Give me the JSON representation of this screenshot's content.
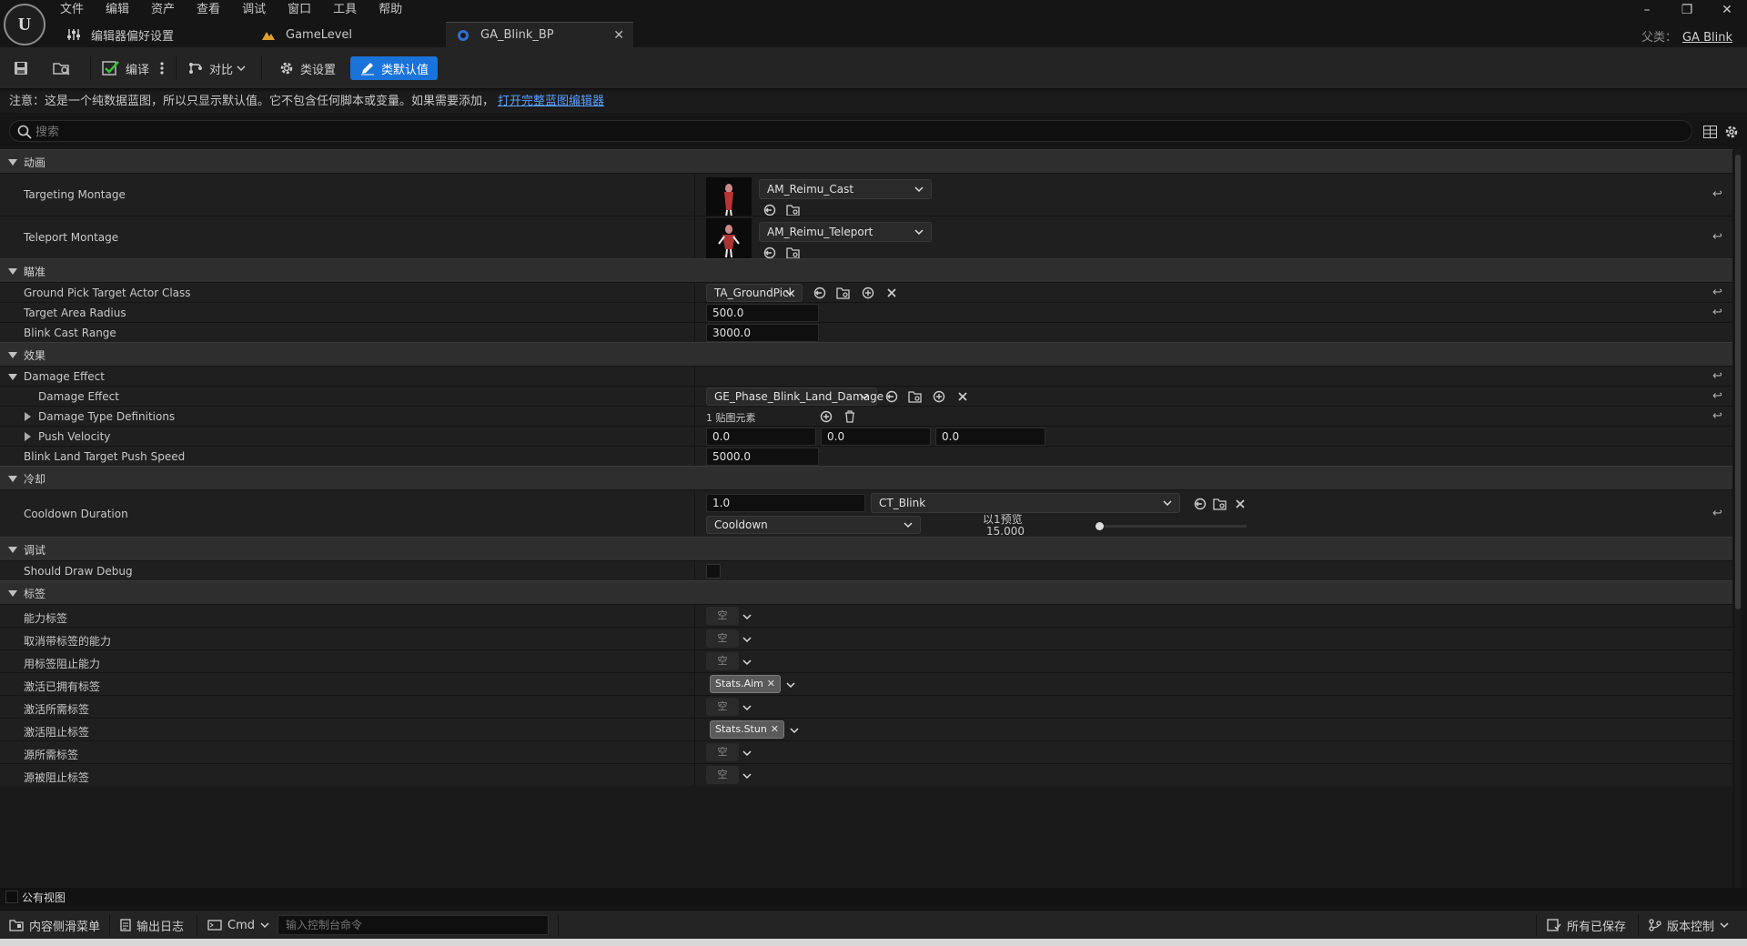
{
  "menu": [
    "文件",
    "编辑",
    "资产",
    "查看",
    "调试",
    "窗口",
    "工具",
    "帮助"
  ],
  "tabs": {
    "editor_prefs": "编辑器偏好设置",
    "game_level": "GameLevel",
    "blink_bp": "GA_Blink_BP"
  },
  "parent": {
    "label": "父类：",
    "value": "GA Blink"
  },
  "toolbar": {
    "compile": "编译",
    "diff": "对比",
    "class_settings": "类设置",
    "class_defaults": "类默认值"
  },
  "notice": {
    "text": "注意：这是一个纯数据蓝图，所以只显示默认值。它不包含任何脚本或变量。如果需要添加，",
    "link": "打开完整蓝图编辑器"
  },
  "search": {
    "placeholder": "搜索"
  },
  "categories": {
    "animation": "动画",
    "aim": "瞄准",
    "effect": "效果",
    "cooldown": "冷却",
    "debug": "调试",
    "tags": "标签"
  },
  "rows": {
    "targeting_montage": {
      "label": "Targeting Montage",
      "value": "AM_Reimu_Cast"
    },
    "teleport_montage": {
      "label": "Teleport Montage",
      "value": "AM_Reimu_Teleport"
    },
    "ground_pick": {
      "label": "Ground Pick Target Actor Class",
      "value": "TA_GroundPick"
    },
    "target_area_radius": {
      "label": "Target Area Radius",
      "value": "500.0"
    },
    "blink_cast_range": {
      "label": "Blink Cast Range",
      "value": "3000.0"
    },
    "damage_effect_group": {
      "label": "Damage Effect"
    },
    "damage_effect": {
      "label": "Damage Effect",
      "value": "GE_Phase_Blink_Land_Damage"
    },
    "damage_type_definitions": {
      "label": "Damage Type Definitions",
      "value": "1 贴图元素"
    },
    "push_velocity": {
      "label": "Push Velocity",
      "x": "0.0",
      "y": "0.0",
      "z": "0.0"
    },
    "push_speed": {
      "label": "Blink Land Target Push Speed",
      "value": "5000.0"
    },
    "cooldown_duration": {
      "label": "Cooldown Duration",
      "value": "1.0",
      "curve": "CT_Blink",
      "row": "Cooldown",
      "preview_label": "以1预览",
      "preview_value": "15.000",
      "preview_slider": 0.0
    },
    "should_draw_debug": {
      "label": "Should Draw Debug"
    }
  },
  "tags": {
    "empty_text": "空",
    "ability_tags": "能力标签",
    "cancel_tags": "取消带标签的能力",
    "block_tags": "用标签阻止能力",
    "activation_owned": "激活已拥有标签",
    "activation_owned_chip": "Stats.Aim",
    "activation_required": "激活所需标签",
    "activation_blocked": "激活阻止标签",
    "activation_blocked_chip": "Stats.Stun",
    "source_required": "源所需标签",
    "source_blocked": "源被阻止标签"
  },
  "public_view": "公有视图",
  "statusbar": {
    "content_drawer": "内容侧滑菜单",
    "output_log": "输出日志",
    "cmd": "Cmd",
    "console_placeholder": "输入控制台命令",
    "all_saved": "所有已保存",
    "source_control": "版本控制"
  },
  "colors": {
    "accent": "#1a73d8",
    "link": "#5aa0ff",
    "thumb_underline": "#5a3fb0"
  }
}
